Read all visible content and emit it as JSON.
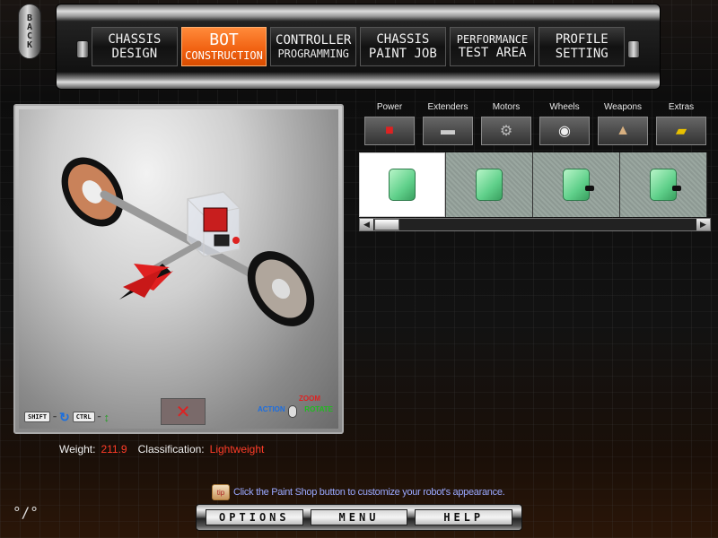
{
  "nav": {
    "back_label": "BACK",
    "tabs": [
      {
        "line1": "CHASSIS",
        "line2": "DESIGN",
        "active": false
      },
      {
        "line1": "BOT",
        "line2": "CONSTRUCTION",
        "active": true
      },
      {
        "line1": "CONTROLLER",
        "line2": "PROGRAMMING",
        "active": false
      },
      {
        "line1": "CHASSIS",
        "line2": "PAINT JOB",
        "active": false
      },
      {
        "line1": "PERFORMANCE",
        "line2": "TEST AREA",
        "active": false
      },
      {
        "line1": "PROFILE",
        "line2": "SETTING",
        "active": false
      }
    ]
  },
  "viewport": {
    "shift_key": "SHIFT",
    "ctrl_key": "CTRL",
    "zoom_label": "ZOOM",
    "action_label": "ACTION",
    "rotate_label": "ROTATE"
  },
  "stats": {
    "weight_label": "Weight:",
    "weight_value": "211.9",
    "class_label": "Classification:",
    "class_value": "Lightweight"
  },
  "parts": {
    "categories": [
      {
        "name": "Power",
        "icon": "battery-icon"
      },
      {
        "name": "Extenders",
        "icon": "extender-icon"
      },
      {
        "name": "Motors",
        "icon": "motor-icon"
      },
      {
        "name": "Wheels",
        "icon": "wheel-icon"
      },
      {
        "name": "Weapons",
        "icon": "weapon-icon"
      },
      {
        "name": "Extras",
        "icon": "extras-icon"
      }
    ],
    "items": [
      {
        "icon": "battery-icon",
        "selected": true
      },
      {
        "icon": "battery-icon",
        "selected": false
      },
      {
        "icon": "battery-icon",
        "selected": false
      },
      {
        "icon": "battery-icon",
        "selected": false
      }
    ]
  },
  "tip": {
    "icon_text": "tip",
    "text": "Click the Paint Shop button to customize your robot's appearance."
  },
  "bottom": {
    "options": "OPTIONS",
    "menu": "MENU",
    "help": "HELP"
  },
  "colors": {
    "accent": "#f06010",
    "stat_value": "#ff3c28",
    "tip_text": "#9aa8ff"
  }
}
